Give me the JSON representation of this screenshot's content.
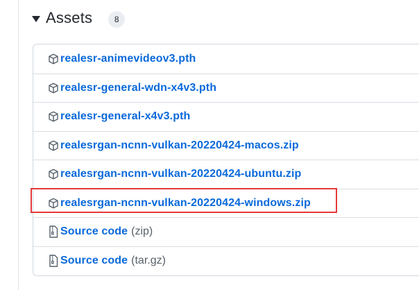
{
  "assets": {
    "title": "Assets",
    "count": "8",
    "items": [
      {
        "label": "realesr-animevideov3.pth",
        "icon": "package-icon"
      },
      {
        "label": "realesr-general-wdn-x4v3.pth",
        "icon": "package-icon"
      },
      {
        "label": "realesr-general-x4v3.pth",
        "icon": "package-icon"
      },
      {
        "label": "realesrgan-ncnn-vulkan-20220424-macos.zip",
        "icon": "package-icon"
      },
      {
        "label": "realesrgan-ncnn-vulkan-20220424-ubuntu.zip",
        "icon": "package-icon"
      },
      {
        "label": "realesrgan-ncnn-vulkan-20220424-windows.zip",
        "icon": "package-icon"
      },
      {
        "label": "Source code",
        "ext": "(zip)",
        "icon": "file-zip-icon"
      },
      {
        "label": "Source code",
        "ext": "(tar.gz)",
        "icon": "file-zip-icon"
      }
    ]
  },
  "colors": {
    "link": "#0969da",
    "highlight": "#e5383b"
  }
}
